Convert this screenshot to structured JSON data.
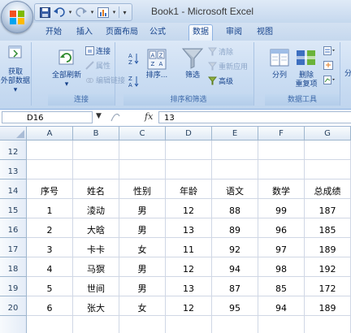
{
  "window": {
    "title": "Book1 - Microsoft Excel"
  },
  "tabs": [
    "开始",
    "插入",
    "页面布局",
    "公式",
    "数据",
    "审阅",
    "视图"
  ],
  "active_tab": "数据",
  "ribbon": {
    "get_external": {
      "line1": "获取",
      "line2": "外部数据",
      "dropdown": "▾"
    },
    "refresh_all": {
      "label": "全部刷新",
      "dropdown": "▾"
    },
    "connections_small": [
      "连接",
      "属性",
      "编辑链接"
    ],
    "connections_group_label": "连接",
    "sort_button": "排序...",
    "filter_button": "筛选",
    "filter_small": [
      "清除",
      "重新应用",
      "高级"
    ],
    "sort_filter_group_label": "排序和筛选",
    "split_column": "分列",
    "remove_duplicates": {
      "line1": "删除",
      "line2": "重复项"
    },
    "data_tools_group_label": "数据工具",
    "cut_off_label": "分"
  },
  "formula_bar": {
    "name_box": "D16",
    "fx_label": "fx",
    "formula": "13"
  },
  "columns": [
    "A",
    "B",
    "C",
    "D",
    "E",
    "F",
    "G"
  ],
  "rows": [
    {
      "num": "12",
      "cells": [
        "",
        "",
        "",
        "",
        "",
        "",
        ""
      ]
    },
    {
      "num": "13",
      "cells": [
        "",
        "",
        "",
        "",
        "",
        "",
        ""
      ]
    },
    {
      "num": "14",
      "cells": [
        "序号",
        "姓名",
        "性别",
        "年龄",
        "语文",
        "数学",
        "总成绩"
      ]
    },
    {
      "num": "15",
      "cells": [
        "1",
        "淩动",
        "男",
        "12",
        "88",
        "99",
        "187"
      ]
    },
    {
      "num": "16",
      "cells": [
        "2",
        "大晗",
        "男",
        "13",
        "89",
        "96",
        "185"
      ]
    },
    {
      "num": "17",
      "cells": [
        "3",
        "卡卡",
        "女",
        "11",
        "92",
        "97",
        "189"
      ]
    },
    {
      "num": "18",
      "cells": [
        "4",
        "马猽",
        "男",
        "12",
        "94",
        "98",
        "192"
      ]
    },
    {
      "num": "19",
      "cells": [
        "5",
        "世间",
        "男",
        "13",
        "87",
        "85",
        "172"
      ]
    },
    {
      "num": "20",
      "cells": [
        "6",
        "张大",
        "女",
        "12",
        "95",
        "94",
        "189"
      ]
    },
    {
      "num": "",
      "cells": [
        "",
        "",
        "",
        "",
        "",
        "",
        ""
      ]
    }
  ],
  "colors": {
    "tab_text": "#15428b",
    "ribbon_bg": "#c9dcf2",
    "header_bg": "#e4ecf7",
    "gridline": "#d0d7e5"
  }
}
